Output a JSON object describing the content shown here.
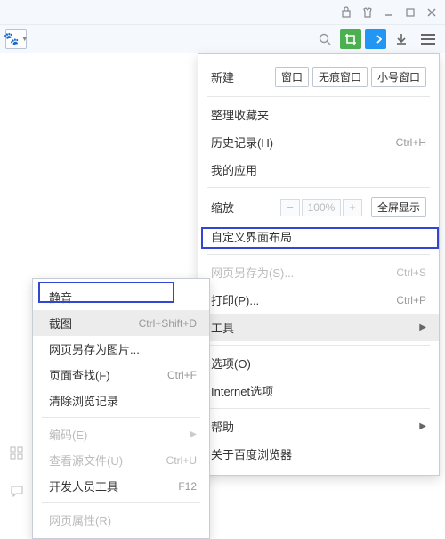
{
  "titlebar": {
    "icons": [
      "bag",
      "shirt",
      "min",
      "max",
      "close"
    ]
  },
  "toolbar": {
    "search": "search",
    "crop": "crop",
    "code": "code",
    "download": "download",
    "menu": "menu"
  },
  "mainMenu": {
    "newLabel": "新建",
    "windowBtn": "窗口",
    "incognitoBtn": "无痕窗口",
    "smallWindowBtn": "小号窗口",
    "bookmarks": "整理收藏夹",
    "history": "历史记录(H)",
    "historyKey": "Ctrl+H",
    "myApps": "我的应用",
    "zoom": "缩放",
    "zoomVal": "100%",
    "fullscreen": "全屏显示",
    "customLayout": "自定义界面布局",
    "saveAs": "网页另存为(S)...",
    "saveAsKey": "Ctrl+S",
    "print": "打印(P)...",
    "printKey": "Ctrl+P",
    "tools": "工具",
    "options": "选项(O)",
    "internetOptions": "Internet选项",
    "help": "帮助",
    "about": "关于百度浏览器"
  },
  "subMenu": {
    "mute": "静音",
    "screenshot": "截图",
    "screenshotKey": "Ctrl+Shift+D",
    "saveAsImage": "网页另存为图片...",
    "findInPage": "页面查找(F)",
    "findKey": "Ctrl+F",
    "clearData": "清除浏览记录",
    "encoding": "编码(E)",
    "viewSource": "查看源文件(U)",
    "viewSourceKey": "Ctrl+U",
    "devTools": "开发人员工具",
    "devToolsKey": "F12",
    "pageProps": "网页属性(R)"
  }
}
